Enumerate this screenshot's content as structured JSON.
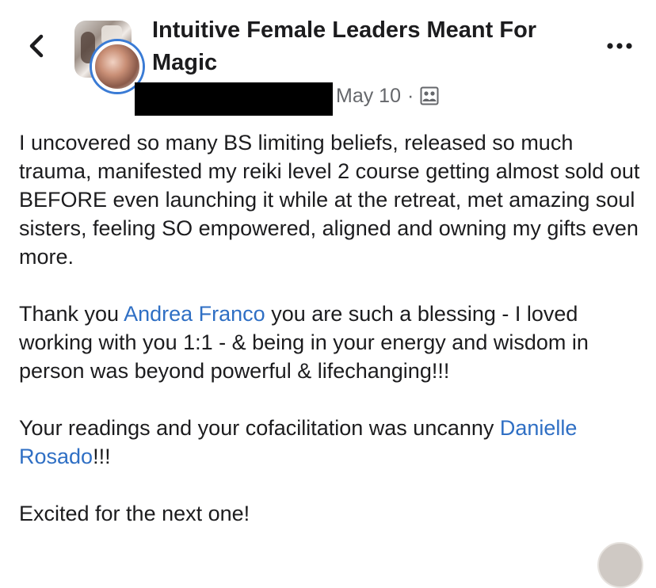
{
  "group": {
    "name": "Intuitive Female Leaders Meant For Magic"
  },
  "post": {
    "date": "May 10",
    "separator": "·",
    "privacy_icon": "group-members-icon",
    "paragraphs": {
      "p1": "I uncovered so many BS limiting beliefs, released so much trauma, manifested my reiki level 2 course getting almost sold out BEFORE even launching it while at the retreat, met amazing soul sisters, feeling SO empowered, aligned and owning my gifts even more.",
      "p2": {
        "before": "Thank you ",
        "mention": "Andrea Franco",
        "after": " you are such a blessing - I loved working with you 1:1 - & being in your energy and wisdom in person was beyond powerful & lifechanging!!!"
      },
      "p3": {
        "before": "Your readings and your cofacilitation was uncanny ",
        "mention": "Danielle Rosado",
        "after": "!!!"
      },
      "p4": "Excited for the next one!"
    }
  },
  "icons": {
    "back": "chevron-left-icon",
    "more": "more-horizontal-icon"
  },
  "colors": {
    "mention": "#2f6fc4",
    "meta_text": "#65676b",
    "avatar_ring": "#3a7bd5",
    "text": "#1c1c1e"
  }
}
